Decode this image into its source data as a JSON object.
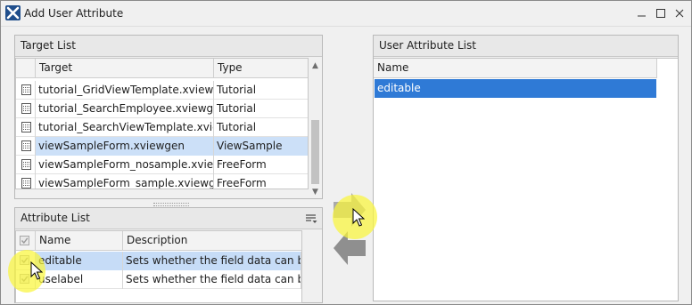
{
  "window": {
    "title": "Add User Attribute",
    "controls": {
      "minimize": "minimize-icon",
      "maximize": "maximize-icon",
      "close": "close-icon"
    }
  },
  "target_list": {
    "title": "Target List",
    "columns": [
      "Target",
      "Type"
    ],
    "rows": [
      {
        "target": "tutorial_GridViewTemplate.xviewgen",
        "type": "Tutorial",
        "selected": false
      },
      {
        "target": "tutorial_SearchEmployee.xviewgen",
        "type": "Tutorial",
        "selected": false
      },
      {
        "target": "tutorial_SearchViewTemplate.xview...",
        "type": "Tutorial",
        "selected": false
      },
      {
        "target": "viewSampleForm.xviewgen",
        "type": "ViewSample",
        "selected": true
      },
      {
        "target": "viewSampleForm_nosample.xview...",
        "type": "FreeForm",
        "selected": false
      },
      {
        "target": "viewSampleForm_sample.xviewgen",
        "type": "FreeForm",
        "selected": false
      }
    ]
  },
  "attribute_list": {
    "title": "Attribute List",
    "columns": [
      "Name",
      "Description"
    ],
    "rows": [
      {
        "name": "editable",
        "description": "Sets whether the field data can be e...",
        "checked": true,
        "selected": true
      },
      {
        "name": "uselabel",
        "description": "Sets whether the field data can be e...",
        "checked": true,
        "selected": false
      }
    ]
  },
  "user_attribute_list": {
    "title": "User Attribute List",
    "columns": [
      "Name"
    ],
    "rows": [
      {
        "name": "editable",
        "selected": true
      }
    ]
  },
  "icons": {
    "app": "app-logo-icon",
    "row": "file-grid-icon",
    "options": "list-options-icon",
    "add": "arrow-right-icon",
    "remove": "arrow-left-icon",
    "cursor": "mouse-pointer-icon"
  },
  "colors": {
    "selection": "#cce0f8",
    "accent": "#1f4e8c",
    "cursor_highlight": "#faf53c"
  }
}
